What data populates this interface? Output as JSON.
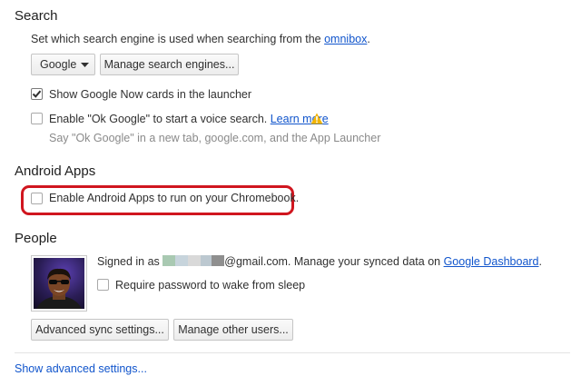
{
  "search": {
    "title": "Search",
    "description_prefix": "Set which search engine is used when searching from the ",
    "omnibox_link": "omnibox",
    "description_suffix": ".",
    "engine_select_value": "Google",
    "manage_engines_button": "Manage search engines...",
    "google_now_label": "Show Google Now cards in the launcher",
    "google_now_checked": true,
    "ok_google_label": "Enable \"Ok Google\" to start a voice search.",
    "learn_more_link": "Learn more",
    "ok_google_checked": false,
    "ok_google_hint": "Say \"Ok Google\" in a new tab, google.com, and the App Launcher"
  },
  "android": {
    "title": "Android Apps",
    "enable_label": "Enable Android Apps to run on your Chromebook.",
    "enable_checked": false
  },
  "people": {
    "title": "People",
    "signed_in_prefix": "Signed in as ",
    "email_suffix": "@gmail.com. Manage your synced data on ",
    "dashboard_link": "Google Dashboard",
    "signed_in_end": ".",
    "require_password_label": "Require password to wake from sleep",
    "require_password_checked": false,
    "advanced_sync_button": "Advanced sync settings...",
    "manage_users_button": "Manage other users..."
  },
  "footer": {
    "show_advanced_link": "Show advanced settings..."
  },
  "colors": {
    "link": "#1155cc",
    "highlight": "#d0161f",
    "warning": "#f2b400"
  }
}
